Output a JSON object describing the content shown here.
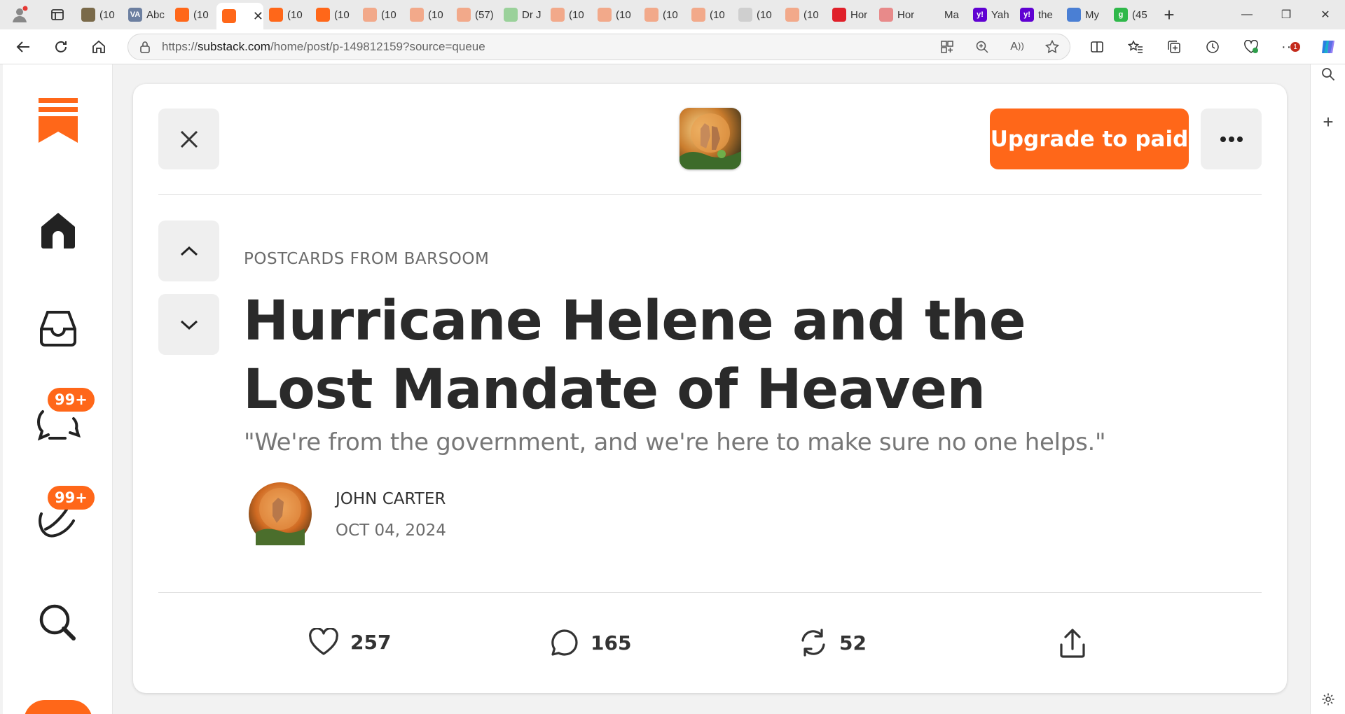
{
  "browser": {
    "tabs": [
      {
        "title": "(10",
        "fav_color": "#7a6a4a",
        "icon": "image-thumb-icon"
      },
      {
        "title": "Abc",
        "fav_color": "#6c7fa0",
        "icon": "va-icon",
        "fav_text": "VA"
      },
      {
        "title": "(10",
        "fav_color": "#ff6719",
        "icon": "substack-icon"
      },
      {
        "title": "",
        "fav_color": "#ff6719",
        "icon": "substack-icon",
        "active": true
      },
      {
        "title": "(10",
        "fav_color": "#ff6719",
        "icon": "substack-icon"
      },
      {
        "title": "(10",
        "fav_color": "#ff6719",
        "icon": "substack-icon"
      },
      {
        "title": "(10",
        "fav_color": "#f2a98a",
        "icon": "substack-icon"
      },
      {
        "title": "(10",
        "fav_color": "#f2a98a",
        "icon": "substack-icon"
      },
      {
        "title": "(57)",
        "fav_color": "#f2a98a",
        "icon": "substack-icon"
      },
      {
        "title": "Dr J",
        "fav_color": "#9ad19a",
        "icon": "play-icon"
      },
      {
        "title": "(10",
        "fav_color": "#f2a98a",
        "icon": "substack-icon"
      },
      {
        "title": "(10",
        "fav_color": "#f2a98a",
        "icon": "substack-icon"
      },
      {
        "title": "(10",
        "fav_color": "#f2a98a",
        "icon": "substack-icon"
      },
      {
        "title": "(10",
        "fav_color": "#f2a98a",
        "icon": "substack-icon"
      },
      {
        "title": "(10",
        "fav_color": "#cfcfcf",
        "icon": "image-thumb-icon"
      },
      {
        "title": "(10",
        "fav_color": "#f2a98a",
        "icon": "substack-icon"
      },
      {
        "title": "Hor",
        "fav_color": "#e0202a",
        "icon": "red-badge-icon"
      },
      {
        "title": "Hor",
        "fav_color": "#e88a8a",
        "icon": "red-badge-icon"
      },
      {
        "title": "Ma",
        "fav_color": "#eaeaea",
        "icon": "search-icon"
      },
      {
        "title": "Yah",
        "fav_color": "#6001d2",
        "icon": "yahoo-icon",
        "fav_text": "y!"
      },
      {
        "title": "the",
        "fav_color": "#6001d2",
        "icon": "yahoo-icon",
        "fav_text": "y!"
      },
      {
        "title": "My",
        "fav_color": "#4a7fd4",
        "icon": "wave-icon"
      },
      {
        "title": "(45",
        "fav_color": "#2fb84a",
        "icon": "grammarly-icon",
        "fav_text": "g"
      }
    ],
    "url_prefix": "https://",
    "url_domain": "substack.com",
    "url_path": "/home/post/p-149812159?source=queue",
    "notification_count": "1"
  },
  "nav": {
    "chat_badge": "99+",
    "activity_badge": "99+"
  },
  "post": {
    "upgrade_label": "Upgrade to paid",
    "publication": "POSTCARDS FROM BARSOOM",
    "title": "Hurricane Helene and the Lost Mandate of Heaven",
    "subtitle": "\"We're from the government, and we're here to make sure no one helps.\"",
    "author": "JOHN CARTER",
    "date": "OCT 04, 2024",
    "likes": "257",
    "comments": "165",
    "restacks": "52"
  },
  "colors": {
    "brand": "#ff6719",
    "badge": "#ff6719"
  }
}
